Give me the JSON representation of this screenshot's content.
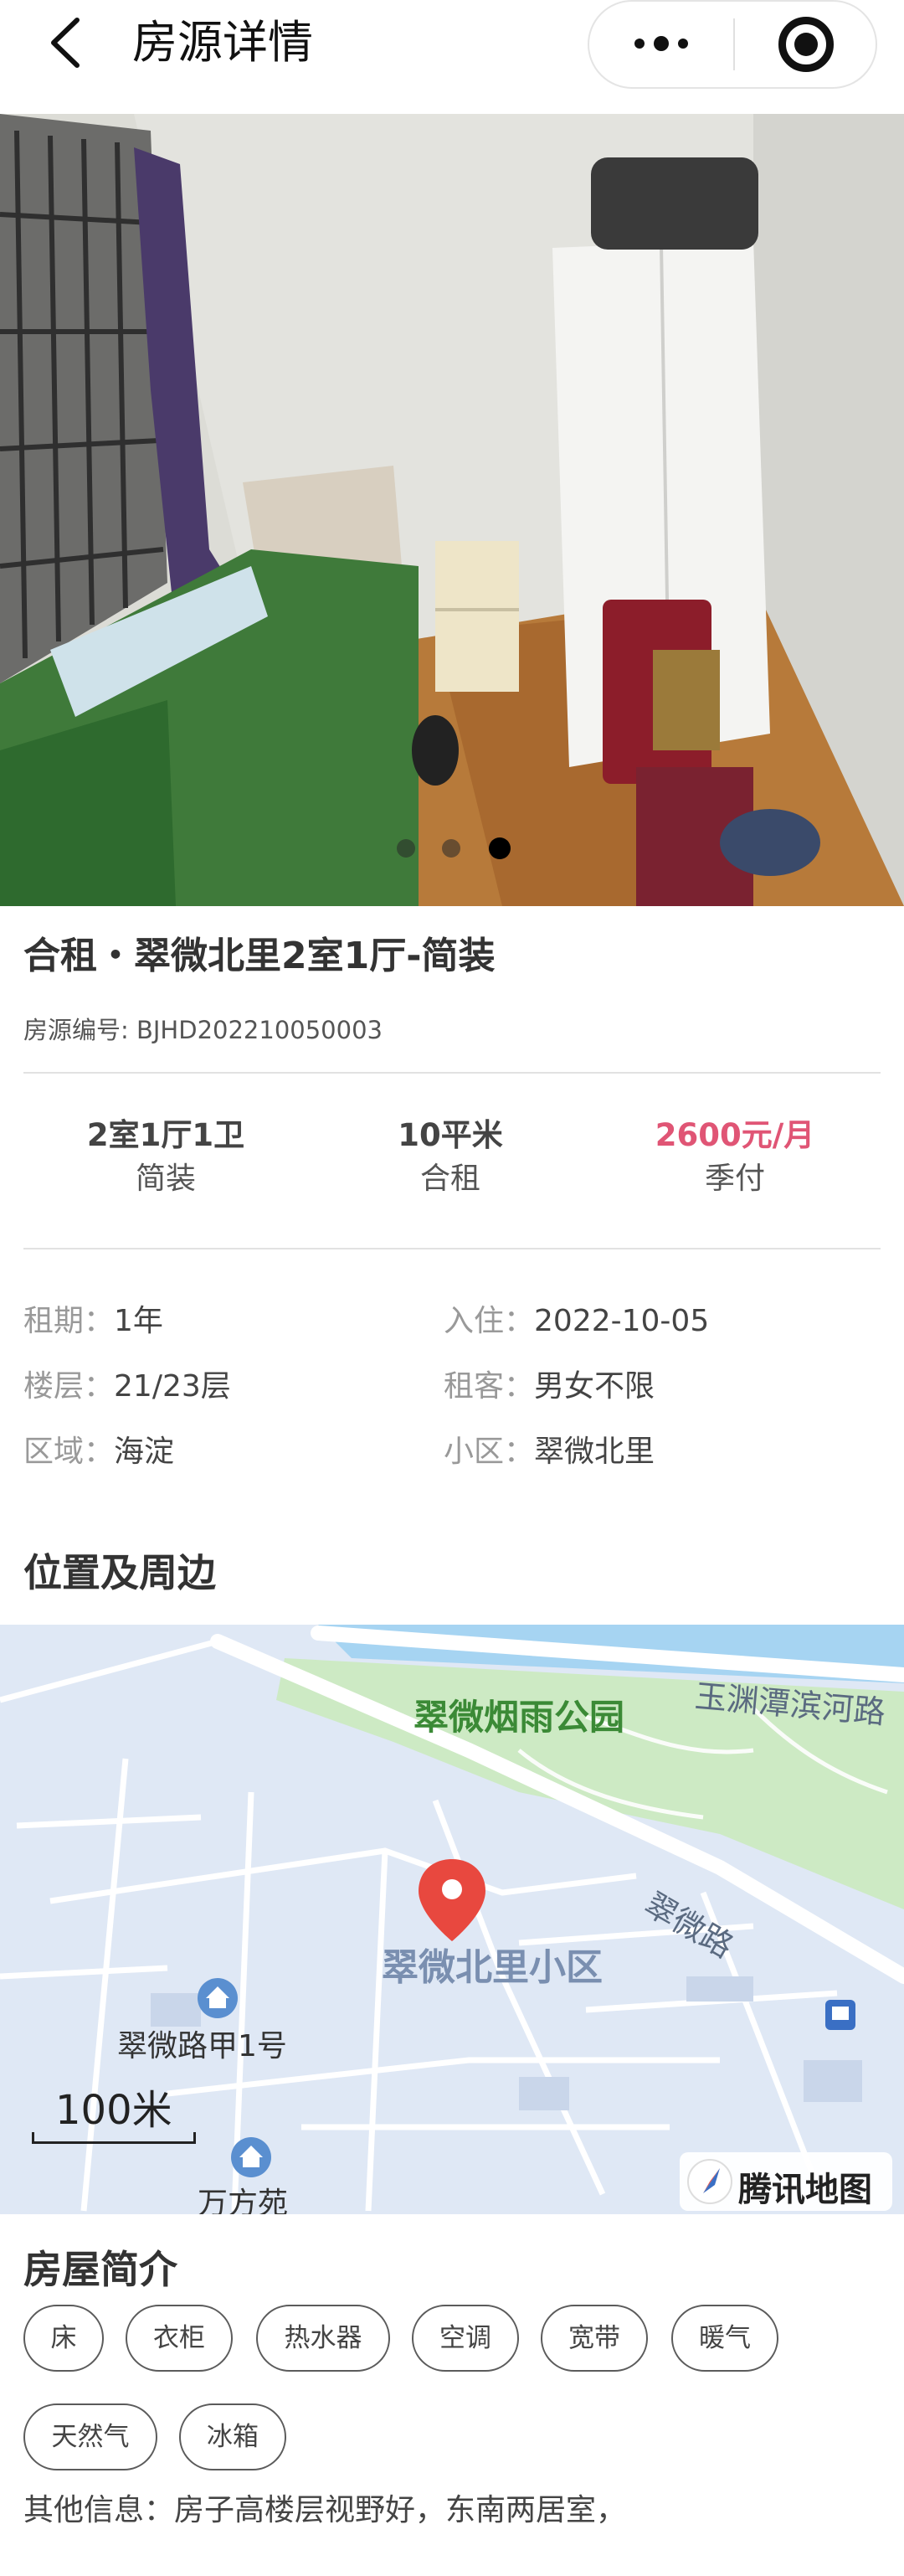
{
  "navbar": {
    "title": "房源详情"
  },
  "carousel": {
    "image_count": 3,
    "active_index": 2
  },
  "listing": {
    "title": "合租・翠微北里2室1厅-简装",
    "code": "房源编号: BJHD202210050003"
  },
  "stats": [
    {
      "primary": "2室1厅1卫",
      "secondary": "简装"
    },
    {
      "primary": "10平米",
      "secondary": "合租"
    },
    {
      "primary": "2600元/月",
      "secondary": "季付"
    }
  ],
  "details": [
    {
      "label": "租期：",
      "value": "1年"
    },
    {
      "label": "入住：",
      "value": "2022-10-05"
    },
    {
      "label": "楼层：",
      "value": "21/23层"
    },
    {
      "label": "租客：",
      "value": "男女不限"
    },
    {
      "label": "区域：",
      "value": "海淀"
    },
    {
      "label": "小区：",
      "value": "翠微北里"
    }
  ],
  "location_section": {
    "title": "位置及周边"
  },
  "map": {
    "labels": {
      "park": "翠微烟雨公园",
      "river_road": "玉渊潭滨河路",
      "main_road": "翠微路",
      "community": "翠微北里小区",
      "poi_1": "翠微路甲1号",
      "poi_2": "万方苑"
    },
    "scale": "100米",
    "logo": "腾讯地图",
    "colors": {
      "water": "#a6d4f2",
      "park": "#cdeac4",
      "land": "#dfe8f5",
      "marker": "#e8483f"
    }
  },
  "intro_section": {
    "title": "房屋简介",
    "tags": [
      "床",
      "衣柜",
      "热水器",
      "空调",
      "宽带",
      "暖气",
      "天然气",
      "冰箱"
    ],
    "other_info": "其他信息：房子高楼层视野好，东南两居室，"
  },
  "colors": {
    "price": "#e05575",
    "muted_label": "#999999"
  }
}
